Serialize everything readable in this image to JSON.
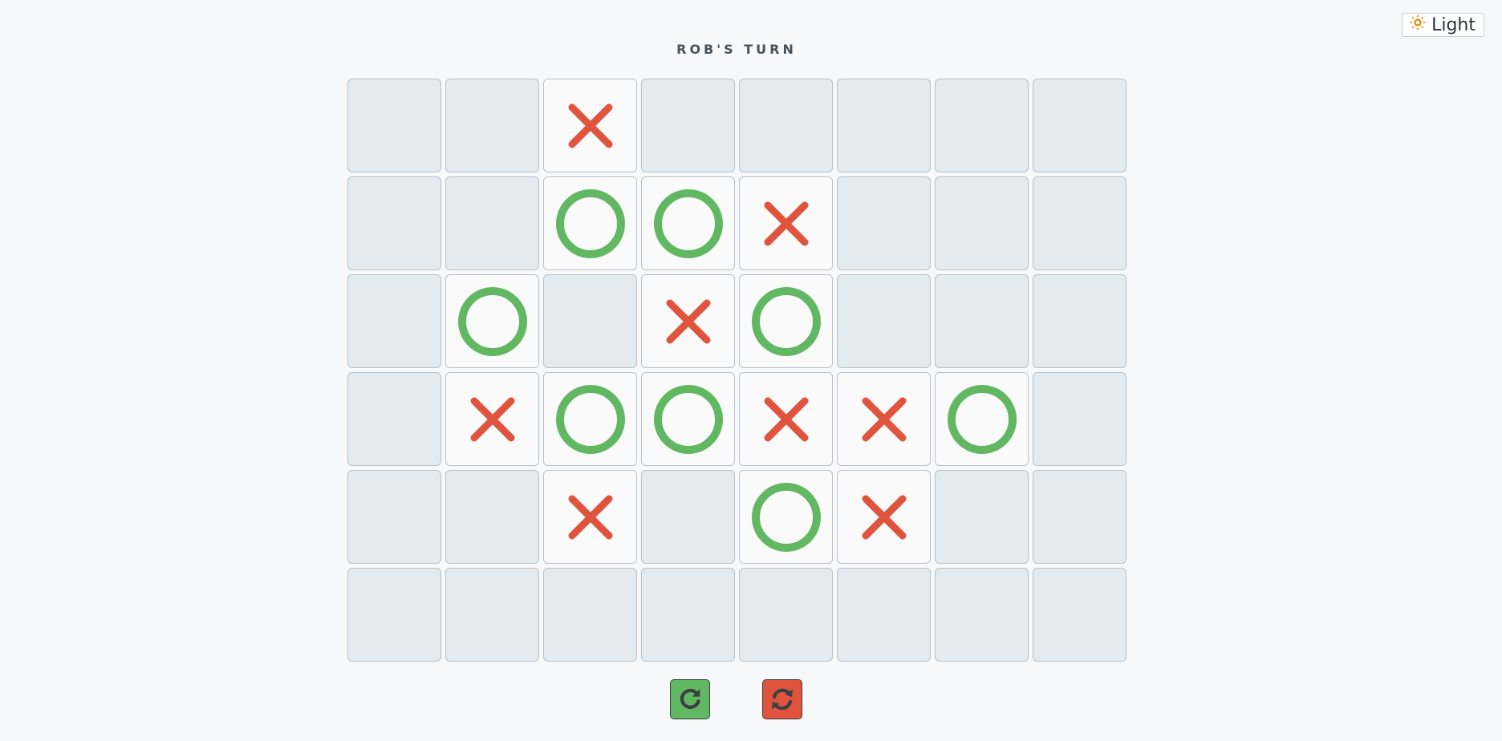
{
  "theme_toggle": {
    "label": "Light",
    "icon": "sun-icon",
    "icon_color": "#e58e1a"
  },
  "status": {
    "turn_text": "ROB'S TURN"
  },
  "colors": {
    "x": "#e0533d",
    "o": "#62b862",
    "empty_cell": "#e3ebf1",
    "filled_cell": "#fafafa"
  },
  "board": {
    "rows": 6,
    "cols": 8,
    "cells": [
      [
        "",
        "",
        "X",
        "",
        "",
        "",
        "",
        ""
      ],
      [
        "",
        "",
        "O",
        "O",
        "X",
        "",
        "",
        ""
      ],
      [
        "",
        "O",
        "",
        "X",
        "O",
        "",
        "",
        ""
      ],
      [
        "",
        "X",
        "O",
        "O",
        "X",
        "X",
        "O",
        ""
      ],
      [
        "",
        "",
        "X",
        "",
        "O",
        "X",
        "",
        ""
      ],
      [
        "",
        "",
        "",
        "",
        "",
        "",
        "",
        ""
      ]
    ]
  },
  "controls": [
    {
      "name": "redo-button",
      "icon": "redo-icon",
      "color": "green"
    },
    {
      "name": "restart-button",
      "icon": "refresh-icon",
      "color": "red"
    }
  ]
}
